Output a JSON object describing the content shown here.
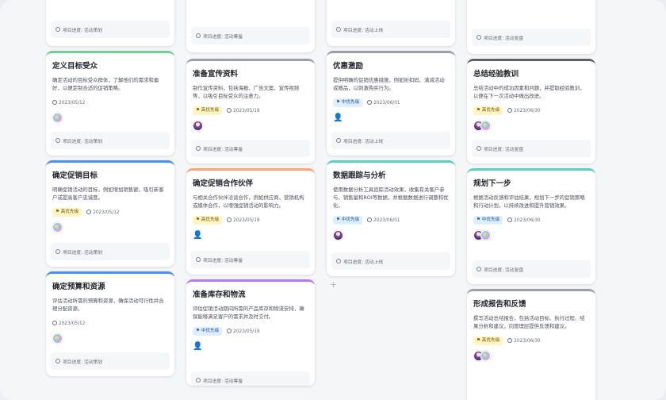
{
  "colors": {
    "high": "#fff4c2",
    "mid": "#ddeeff",
    "blue": "#4c8df6",
    "green": "#6fcf97",
    "grey": "#9aa0a6",
    "orange": "#f6a77a",
    "purple": "#b57ce8",
    "teal": "#5ccfc0",
    "dark": "#5f6368"
  },
  "stage_prefix": "项目进度:",
  "columns": [
    {
      "top_stage": "项目进度: 活动策划",
      "cards": [
        {
          "title": "定义目标受众",
          "desc": "确定活动的目标受众群体，了解他们的需求和偏好，以便定制合适的促销策略。",
          "tag": "",
          "date": "2023/05/12",
          "people": [
            "a"
          ],
          "stage": "项目进度: 活动策划"
        },
        {
          "title": "确定促销目标",
          "desc": "明确促销活动的目标，例如增加销售额、吸引新客户或提高客户忠诚度。",
          "tag": "高优先级",
          "date": "2023/05/12",
          "people": [
            "a"
          ],
          "stage": "项目进度: 活动策划"
        },
        {
          "title": "确定预算和资源",
          "desc": "评估活动所需的预算和资源，确保活动可行性并合理分配资源。",
          "tag": "",
          "date": "2023/05/12",
          "people": [
            "a"
          ],
          "stage": "项目进度: 活动策划"
        }
      ]
    },
    {
      "top_stage": "项目进度: 活动筹备",
      "cards": [
        {
          "title": "准备宣传资料",
          "desc": "制作宣传资料，包括海报、广告文案、宣传视频等，以吸引目标受众的注意力。",
          "tag": "高优先级",
          "date": "2023/05/19",
          "people": [
            "b"
          ],
          "stage": "项目进度: 活动筹备"
        },
        {
          "title": "确定促销合作伙伴",
          "desc": "与相关合作伙伴洽谈合作，例如供应商、营销机构或媒体合作，以增强促销活动的影响力。",
          "tag": "高优先级",
          "date": "2023/05/19",
          "people": [],
          "stage": "项目进度: 活动筹备"
        },
        {
          "title": "准备库存和物流",
          "desc": "评估促销活动期间所需的产品库存和物流安排，确保能够满足客户的需求并及时交付。",
          "tag": "中优先级",
          "date": "2023/05/19",
          "people": [],
          "stage": "项目进度: 活动筹备"
        }
      ]
    },
    {
      "top_stage": "项目进度: 活动上线",
      "cards": [
        {
          "title": "优惠激励",
          "desc": "提供明确的促销优惠措施，例如折扣码、满减活动或赠品，以刺激购买行为。",
          "tag": "中优先级",
          "date": "2023/06/01",
          "people": [],
          "stage": "项目进度: 活动上线"
        },
        {
          "title": "数据跟踪与分析",
          "desc": "使用数据分析工具追踪活动效果，收集有关客户参与、销售量和ROI等数据，并根据数据进行调整和优化。",
          "tag": "中优先级",
          "date": "2023/06/01",
          "people": [
            "b"
          ],
          "stage": "项目进度: 活动上线"
        }
      ]
    },
    {
      "top_stage": "项目进度: 活动复盘",
      "cards": [
        {
          "title": "总结经验教训",
          "desc": "总结活动中的成功因素和问题，并提取经验教训，以便在下一次活动中做出改进。",
          "tag": "高优先级",
          "date": "2023/06/30",
          "people": [
            "b",
            "a"
          ],
          "stage": "项目进度: 活动复盘"
        },
        {
          "title": "规划下一步",
          "desc": "根据活动反馈和评估结果，规划下一步的促销策略和行动计划，以持续改进和提升营销效果。",
          "tag": "中优先级",
          "date": "2023/06/30",
          "people": [
            "b",
            "a"
          ],
          "stage": "项目进度: 活动复盘"
        },
        {
          "title": "形成报告和反馈",
          "desc": "撰写活动总结报告，包括活动目标、执行过程、结果分析和建议，向管理层提供反馈和建议。",
          "tag": "高优先级",
          "date": "2023/06/30",
          "people": [
            "b",
            "a"
          ],
          "stage": ""
        }
      ]
    }
  ],
  "add_label": "+"
}
